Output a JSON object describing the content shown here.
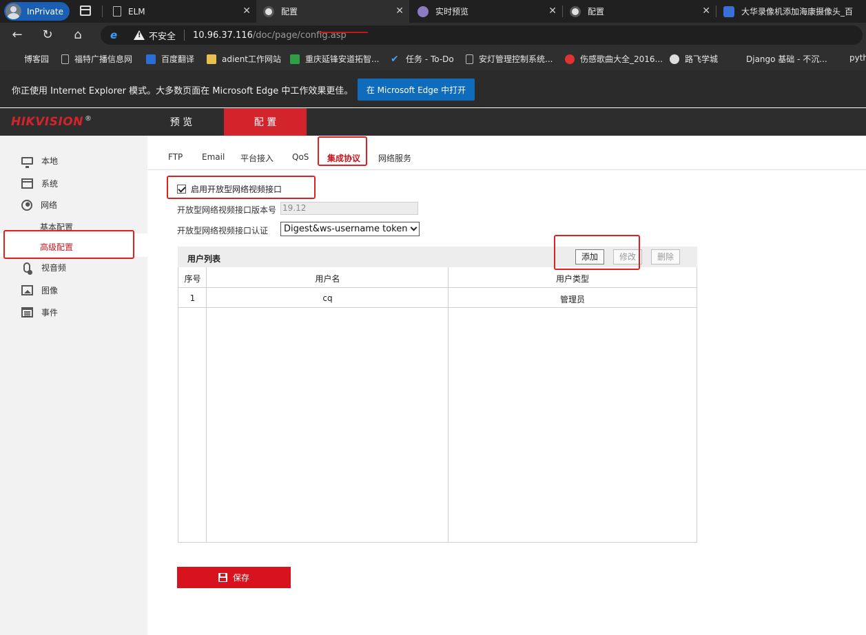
{
  "browser": {
    "inprivate_label": "InPrivate",
    "tabs": [
      {
        "title": "ELM",
        "icon": "document-icon"
      },
      {
        "title": "配置",
        "icon": "camera-icon"
      },
      {
        "title": "实时预览",
        "icon": "webcam-icon"
      },
      {
        "title": "配置",
        "icon": "camera-icon"
      },
      {
        "title": "大华录像机添加海康摄像头_百",
        "icon": "baidu-paw-icon"
      }
    ],
    "address": {
      "security_label": "不安全",
      "host": "10.96.37.116",
      "path": "/doc/page/config.asp"
    },
    "favorites": [
      "博客园",
      "福特广播信息网",
      "百度翻译",
      "adient工作网站",
      "重庆延锋安道拓智...",
      "任务 - To-Do",
      "安灯管理控制系统...",
      "伤感歌曲大全_2016...",
      "路飞学城",
      "Django 基础 - 不沉...",
      "pyth"
    ],
    "ie_mode": {
      "message": "你正使用 Internet Explorer 模式。大多数页面在 Microsoft Edge 中工作效果更佳。",
      "button": "在 Microsoft Edge 中打开"
    }
  },
  "app": {
    "logo": "HIKVISION",
    "logo_mark": "®",
    "nav": {
      "preview": "预 览",
      "config": "配 置"
    },
    "sidebar": {
      "local": "本地",
      "system": "系统",
      "network": "网络",
      "basic_config": "基本配置",
      "advanced_config": "高级配置",
      "video_audio": "视音频",
      "image": "图像",
      "event": "事件"
    },
    "tabs": [
      "FTP",
      "Email",
      "平台接入",
      "QoS",
      "集成协议",
      "网络服务"
    ],
    "form": {
      "enable_label": "启用开放型网络视频接口",
      "version_label": "开放型网络视频接口版本号",
      "version_value": "19.12",
      "auth_label": "开放型网络视频接口认证",
      "auth_value": "Digest&ws-username token"
    },
    "user_list": {
      "title": "用户列表",
      "add": "添加",
      "modify": "修改",
      "delete": "删除",
      "columns": [
        "序号",
        "用户名",
        "用户类型"
      ],
      "rows": [
        {
          "no": "1",
          "name": "cq",
          "type": "管理员"
        }
      ]
    },
    "save": "保存"
  },
  "colors": {
    "accent": "#d3242c",
    "highlight_box": "#e02020"
  }
}
